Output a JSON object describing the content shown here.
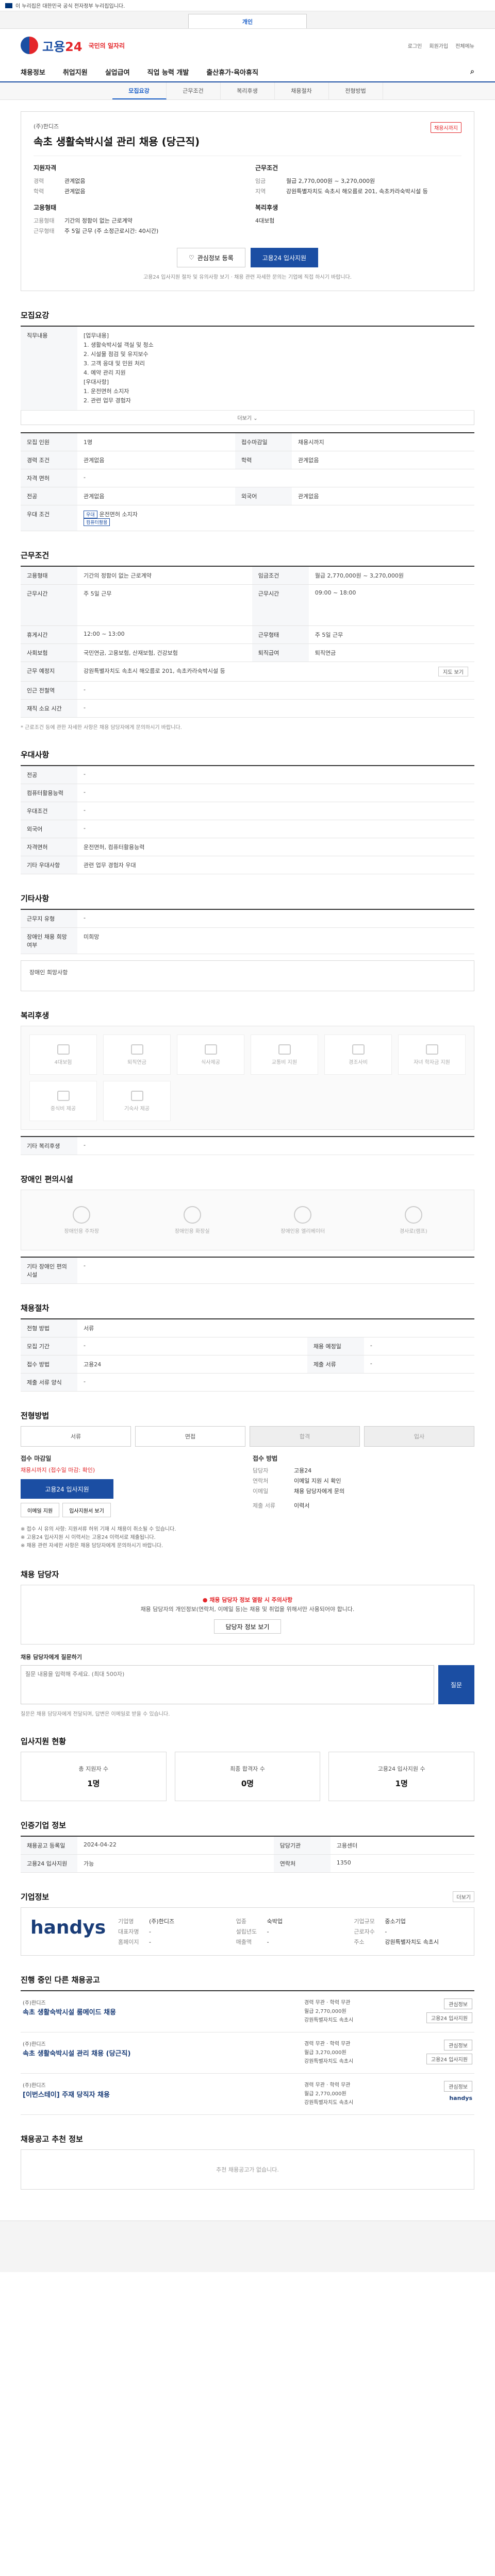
{
  "topbar": {
    "text": "이 누리집은 대한민국 공식 전자정부 누리집입니다."
  },
  "toptabs": [
    "개인"
  ],
  "header": {
    "logo_main": "고용",
    "logo_num": "24",
    "logo_sub": "국민의 일자리",
    "links": [
      "로그인",
      "회원가입",
      "전체메뉴"
    ]
  },
  "gnb": [
    "채용정보",
    "취업지원",
    "실업급여",
    "직업 능력 개발",
    "출산휴가·육아휴직"
  ],
  "subnav": {
    "items": [
      "모집요강",
      "근무조건",
      "복리후생",
      "채용절차",
      "전형방법"
    ],
    "active": 0
  },
  "job": {
    "company": "(주)한디즈",
    "badge": "채용시까지",
    "title": "속초 생활숙박시설 관리 채용 (당근직)",
    "req_title": "지원자격",
    "req": [
      [
        "경력",
        "관계없음"
      ],
      [
        "학력",
        "관계없음"
      ]
    ],
    "cond_title": "근무조건",
    "cond": [
      [
        "임금",
        "월급 2,770,000원 ~ 3,270,000원"
      ],
      [
        "지역",
        "강원특별자치도 속초시 해오름로 201, 속초카라숙박시설 등"
      ]
    ],
    "type_title": "고용형태",
    "type": [
      [
        "고용형태",
        "기간의 정함이 없는 근로계약"
      ],
      [
        "근무형태",
        "주 5일 근무 (주 소정근로시간: 40시간)"
      ]
    ],
    "welfare_title": "복리후생",
    "welfare": "4대보험",
    "btn_scrap": "관심정보 등록",
    "btn_apply": "고용24 입사지원",
    "note": "고용24 입사지원 절차 및 유의사항 보기 · 채용 관련 자세한 문의는 기업에 직접 하시기 바랍니다."
  },
  "recruit": {
    "h": "모집요강",
    "duty_label": "직무내용",
    "duty": "[업무내용]\n1. 생활숙박시설 객실 및 청소\n2. 시설물 점검 및 유지보수\n3. 고객 응대 및 민원 처리\n4. 예약 관리 지원\n[우대사항]\n1. 운전면허 소지자\n2. 관련 업무 경험자",
    "fold": "더보기",
    "rows": [
      [
        "모집 인원",
        "1명",
        "접수마감일",
        "채용시까지"
      ],
      [
        "경력 조건",
        "관계없음",
        "학력",
        "관계없음"
      ],
      [
        "자격 면허",
        "-",
        "",
        ""
      ],
      [
        "전공",
        "관계없음",
        "외국어",
        "관계없음"
      ],
      [
        "우대 조건",
        "운전면허 소지자",
        "",
        ""
      ]
    ],
    "tags": [
      "우대",
      "컴퓨터활용"
    ]
  },
  "work": {
    "h": "근무조건",
    "rows": [
      [
        "고용형태",
        "기간의 정함이 없는 근로계약",
        "임금조건",
        "월급 2,770,000원 ~ 3,270,000원"
      ],
      [
        "근무시간",
        "주 5일 근무",
        "근무시간",
        "09:00 ~ 18:00"
      ],
      [
        "휴게시간",
        "12:00 ~ 13:00",
        "근무형태",
        "주 5일 근무"
      ],
      [
        "사회보험",
        "국민연금, 고용보험, 산재보험, 건강보험",
        "퇴직급여",
        "퇴직연금"
      ],
      [
        "근무 예정지",
        "강원특별자치도 속초시 해오름로 201, 속초카라숙박시설 등",
        "",
        ""
      ],
      [
        "인근 전철역",
        "-",
        "",
        ""
      ],
      [
        "재직 소요 시간",
        "-",
        "",
        ""
      ]
    ],
    "more": "지도 보기",
    "note": "* 근로조건 등에 관한 자세한 사항은 채용 담당자에게 문의하시기 바랍니다."
  },
  "extra": {
    "h": "우대사항",
    "rows": [
      [
        "전공",
        "-"
      ],
      [
        "컴퓨터활용능력",
        "-"
      ],
      [
        "우대조건",
        "-"
      ],
      [
        "외국어",
        "-"
      ],
      [
        "자격면허",
        "운전면허, 컴퓨터활용능력"
      ],
      [
        "기타 우대사항",
        "관련 업무 경험자 우대"
      ]
    ]
  },
  "misc": {
    "h": "기타사항",
    "rows": [
      [
        "근무지 유형",
        "-"
      ],
      [
        "장애인 채용 희망 여부",
        "미희망"
      ]
    ],
    "link": "장애인 희망사항"
  },
  "welfare": {
    "h": "복리후생",
    "icons": [
      "4대보험",
      "퇴직연금",
      "식사제공",
      "교통비 지원",
      "경조사비",
      "자녀 학자금 지원",
      "중식비 제공",
      "기숙사 제공"
    ],
    "other_label": "기타 복리후생",
    "other": "-"
  },
  "disabled": {
    "h": "장애인 편의시설",
    "icons": [
      "장애인용 주차장",
      "장애인용 화장실",
      "장애인용 엘리베이터",
      "경사로(램프)"
    ],
    "other_label": "기타 장애인 편의시설",
    "other": "-"
  },
  "process": {
    "h": "채용절차",
    "rows": [
      [
        "전형 방법",
        "서류",
        "",
        ""
      ],
      [
        "모집 기간",
        "-",
        "채용 예정일",
        "-"
      ],
      [
        "접수 방법",
        "고용24",
        "제출 서류",
        "-"
      ],
      [
        "제출 서류 양식",
        "-",
        "",
        ""
      ]
    ]
  },
  "apply": {
    "h": "전형방법",
    "steps": [
      "서류",
      "면접",
      "합격",
      "입사"
    ],
    "left_title": "접수 마감일",
    "deadline_label": "채용시까지 (접수일 마감: 확인)",
    "btn_apply": "고용24 입사지원",
    "btn_email": "이메일 지원",
    "btn_print": "입사지원서 보기",
    "right_title": "접수 방법",
    "contact": [
      [
        "담당자",
        "고용24"
      ],
      [
        "연락처",
        "이메일 지원 시 확인"
      ],
      [
        "이메일",
        "채용 담당자에게 문의"
      ]
    ],
    "method_label": "제출 서류",
    "method": "이력서",
    "warn": "※ 접수 시 유의 사항: 지원서류 허위 기재 시 채용이 취소될 수 있습니다.\n※ 고용24 입사지원 시 이력서는 고용24 이력서로 제출됩니다.\n※ 채용 관련 자세한 사항은 채용 담당자에게 문의하시기 바랍니다."
  },
  "qna": {
    "h": "채용 담당자",
    "warn_title": "채용 담당자 정보 열람 시 주의사항",
    "warn_body": "채용 담당자의 개인정보(연락처, 이메일 등)는 채용 및 취업을 위해서만 사용되어야 합니다.",
    "btn_view": "담당자 정보 보기",
    "q_label": "채용 담당자에게 질문하기",
    "q_placeholder": "질문 내용을 입력해 주세요. (최대 500자)",
    "send": "질문",
    "q_note": "질문은 채용 담당자에게 전달되며, 답변은 이메일로 받을 수 있습니다."
  },
  "stats": {
    "h": "입사지원 현황",
    "items": [
      [
        "총 지원자 수",
        "1명"
      ],
      [
        "최종 합격자 수",
        "0명"
      ],
      [
        "고용24 입사지원 수",
        "1명"
      ]
    ]
  },
  "meta": {
    "h": "인증기업 정보",
    "rows": [
      [
        "채용공고 등록일",
        "2024-04-22",
        "담당기관",
        "고용센터"
      ],
      [
        "고용24 입사지원",
        "가능",
        "연락처",
        "1350"
      ]
    ]
  },
  "company": {
    "h": "기업정보",
    "more": "더보기",
    "logo": "handys",
    "info": [
      [
        "기업명",
        "(주)한디즈"
      ],
      [
        "업종",
        "숙박업"
      ],
      [
        "기업규모",
        "중소기업"
      ],
      [
        "대표자명",
        "-"
      ],
      [
        "설립년도",
        "-"
      ],
      [
        "근로자수",
        "-"
      ],
      [
        "홈페이지",
        "-"
      ],
      [
        "매출액",
        "-"
      ],
      [
        "주소",
        "강원특별자치도 속초시"
      ]
    ]
  },
  "others": {
    "h": "진행 중인 다른 채용공고",
    "jobs": [
      {
        "company": "(주)한디즈",
        "title": "속초 생활숙박시설 룸메이드 채용",
        "meta": [
          "경력 무관 · 학력 무관",
          "월급 2,770,000원",
          "강원특별자치도 속초시"
        ],
        "b1": "관심정보",
        "b2": "고용24 입사지원"
      },
      {
        "company": "(주)한디즈",
        "title": "속초 생활숙박시설 관리 채용 (당근직)",
        "meta": [
          "경력 무관 · 학력 무관",
          "월급 3,270,000원",
          "강원특별자치도 속초시"
        ],
        "b1": "관심정보",
        "b2": "고용24 입사지원"
      },
      {
        "company": "(주)한디즈",
        "title": "[이번스테이] 주재 당직자 채용",
        "meta": [
          "경력 무관 · 학력 무관",
          "월급 2,770,000원",
          "강원특별자치도 속초시"
        ],
        "b1": "관심정보",
        "b2": "handys"
      }
    ]
  },
  "recommend": {
    "h": "채용공고 추천 정보",
    "empty": "추천 채용공고가 없습니다."
  }
}
